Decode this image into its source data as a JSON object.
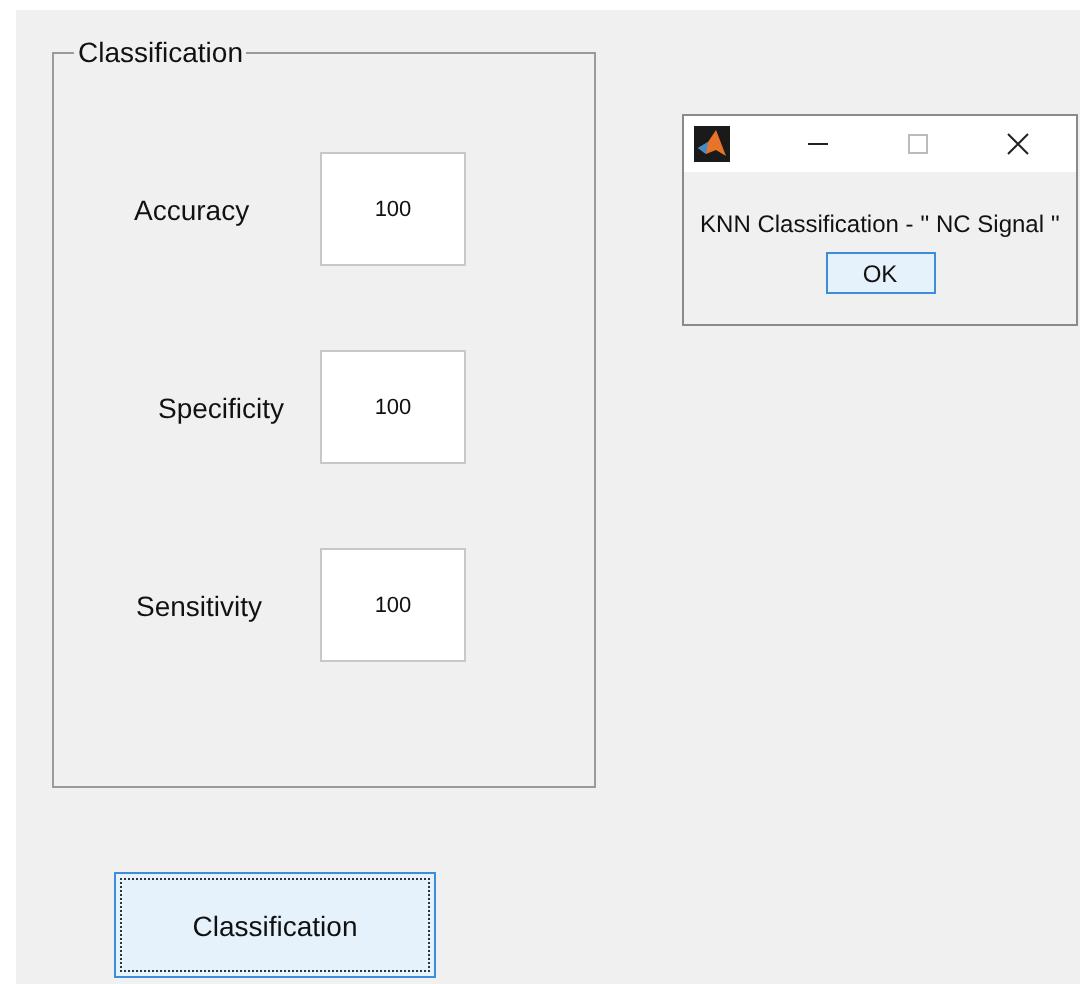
{
  "panel": {
    "title": "Classification"
  },
  "metrics": [
    {
      "label": "Accuracy",
      "value": "100"
    },
    {
      "label": "Specificity",
      "value": "100"
    },
    {
      "label": "Sensitivity",
      "value": "100"
    }
  ],
  "classify_button": {
    "label": "Classification",
    "focused": true
  },
  "dialog": {
    "message": "KNN Classification - '' NC Signal ''",
    "button": "OK"
  }
}
